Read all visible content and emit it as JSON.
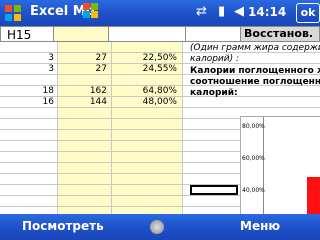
{
  "titlebar": {
    "title": "Excel Mo",
    "time": "14:14",
    "ok_label": "ok"
  },
  "namebox": {
    "value": "H15"
  },
  "restore_button": "Восстанов.",
  "rows": [
    {
      "a": "3",
      "b": "27",
      "c": "22,50%"
    },
    {
      "a": "3",
      "b": "27",
      "c": "24,55%"
    },
    {
      "a": "18",
      "b": "162",
      "c": "64,80%"
    },
    {
      "a": "16",
      "b": "144",
      "c": "48,00%"
    }
  ],
  "note_lines": [
    "(Один грамм жира содержит",
    "калорий) :"
  ],
  "bold_lines": [
    "Калории поглощенного ж",
    "соотношение поглощенн",
    "калорий:"
  ],
  "chart_data": {
    "type": "bar",
    "ytick_labels": [
      "80,00%",
      "60,00%",
      "40,00%"
    ],
    "values": [
      48
    ]
  },
  "menu": {
    "left": "Посмотреть",
    "right": "Меню"
  },
  "colors": {
    "bar_blue": "#1e50c8",
    "cell_yellow": "#fffcc8",
    "bar_red": "#ff1010"
  }
}
